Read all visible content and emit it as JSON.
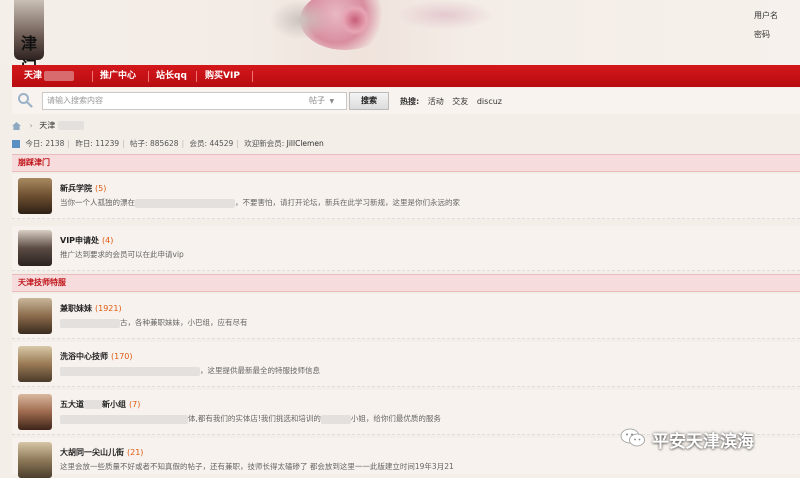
{
  "header": {
    "logo_text": "津门",
    "username_label": "用户名",
    "password_label": "密码"
  },
  "nav": {
    "items": [
      {
        "label": "天津"
      },
      {
        "label": "推广中心"
      },
      {
        "label": "站长qq"
      },
      {
        "label": "购买VIP"
      }
    ]
  },
  "search": {
    "placeholder": "请输入搜索内容",
    "type_selected": "帖子",
    "button_label": "搜索",
    "hot_label": "热搜:",
    "hot_items": [
      "活动",
      "交友",
      "discuz"
    ]
  },
  "breadcrumb": {
    "current": "天津"
  },
  "stats": {
    "today_label": "今日:",
    "today_value": "2138",
    "yesterday_label": "昨日:",
    "yesterday_value": "11239",
    "posts_label": "帖子:",
    "posts_value": "885628",
    "members_label": "会员:",
    "members_value": "44529",
    "welcome_label": "欢迎新会员:",
    "welcome_value": "JillClemen"
  },
  "sections": [
    {
      "title": "崩踩津门",
      "forums": [
        {
          "title": "新兵学院",
          "count": "(5)",
          "desc_pre": "当你一个人孤独的漂在",
          "desc_post": "，不要害怕，请打开论坛，新兵在此学习新规，这里是你们永远的家"
        },
        {
          "title": "VIP申请处",
          "count": "(4)",
          "desc_pre": "推广达到要求的会员可以在此申请vip",
          "desc_post": ""
        }
      ]
    },
    {
      "title": "天津技师特服",
      "forums": [
        {
          "title": "兼职妹妹",
          "count": "(1921)",
          "desc_pre": "",
          "desc_post": "古，各种兼职妹妹，小巴组，应有尽有"
        },
        {
          "title": "洗浴中心技师",
          "count": "(170)",
          "desc_pre": "",
          "desc_post": "，这里提供最新最全的特服技师信息"
        },
        {
          "title": "五大道",
          "title_post": "新小组",
          "count": "(7)",
          "desc_pre": "",
          "desc_post": "体,都有我们的实体店!我们挑选和培训的",
          "desc_post2": "小姐，给你们最优质的服务"
        },
        {
          "title": "大胡同一尖山儿街",
          "count": "(21)",
          "desc_pre": "这里会放一些质量不好或者不知真假的帖子，还有兼职，技师长得太磕碜了 都会放到这里一一此版建立时间19年3月21",
          "desc_post": ""
        }
      ]
    }
  ],
  "watermark": {
    "text": "平安天津滨海"
  },
  "colors": {
    "nav_red": "#c8131a",
    "section_title_red": "#c1141a",
    "count_orange": "#e05a0e"
  }
}
